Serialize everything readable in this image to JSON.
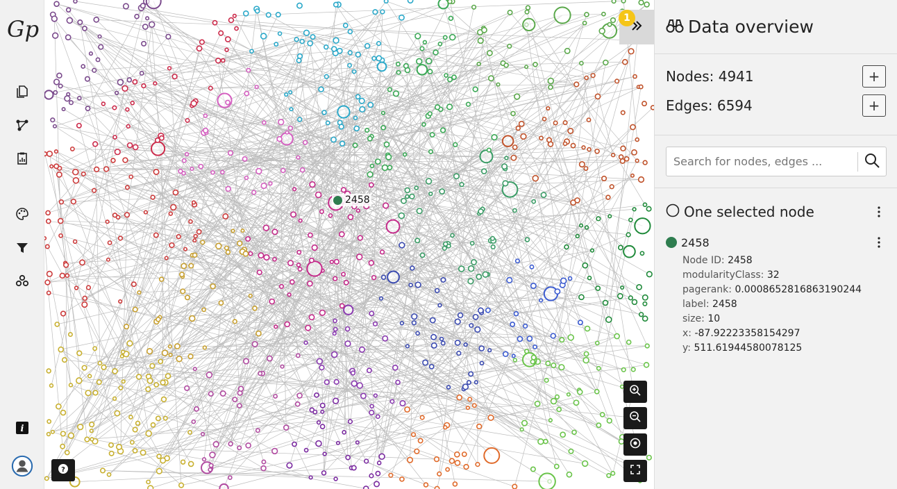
{
  "app": {
    "logo_text": "Gp"
  },
  "leftnav": {
    "items": [
      {
        "name": "file-icon"
      },
      {
        "name": "graph-icon"
      },
      {
        "name": "statistics-icon"
      },
      {
        "name": "appearance-icon"
      },
      {
        "name": "filter-icon"
      },
      {
        "name": "community-icon"
      }
    ],
    "bottom": [
      {
        "name": "info-icon"
      },
      {
        "name": "user-icon"
      }
    ]
  },
  "graph": {
    "selected_label": "2458",
    "notification_count": "1",
    "zoom_controls": [
      "zoom-in-icon",
      "zoom-out-icon",
      "center-icon",
      "fullscreen-icon"
    ],
    "help_icon": "question-icon"
  },
  "panel": {
    "title": "Data overview",
    "nodes_label": "Nodes: 4941",
    "edges_label": "Edges: 6594",
    "search_placeholder": "Search for nodes, edges ...",
    "selection_title": "One selected node",
    "selected_node": {
      "id": "2458",
      "color": "#2e7d4f",
      "attributes": [
        {
          "key": "Node ID:",
          "value": "2458"
        },
        {
          "key": "modularityClass:",
          "value": "32"
        },
        {
          "key": "pagerank:",
          "value": "0.0008652816863190244"
        },
        {
          "key": "label:",
          "value": "2458"
        },
        {
          "key": "size:",
          "value": "10"
        },
        {
          "key": "x:",
          "value": "-87.92223358154297"
        },
        {
          "key": "y:",
          "value": "511.61944580078125"
        }
      ]
    }
  }
}
